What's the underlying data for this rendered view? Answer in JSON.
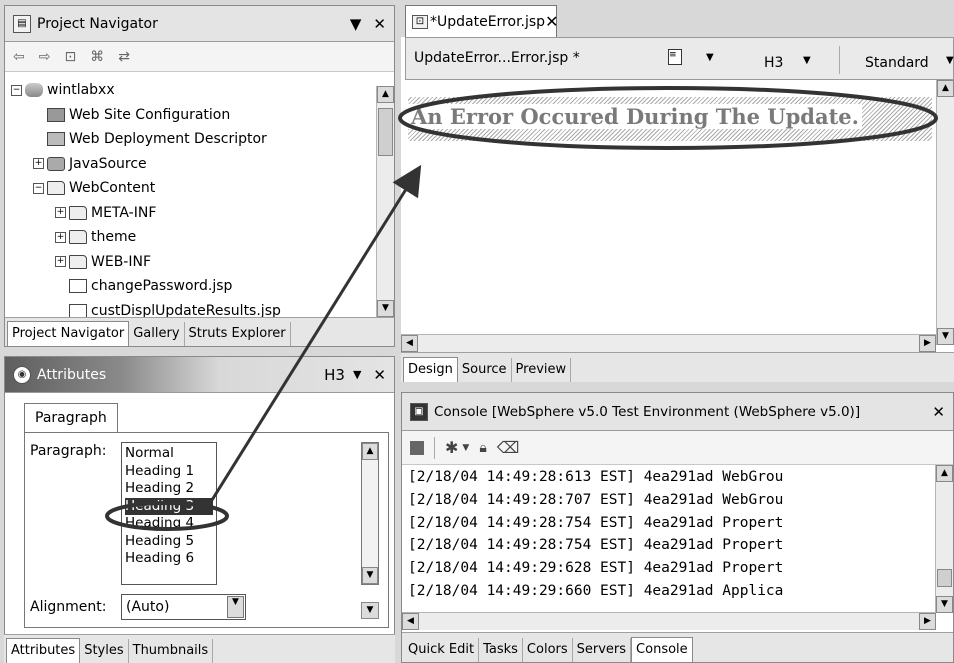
{
  "navigator": {
    "title": "Project Navigator",
    "tree": [
      {
        "label": "wintlabxx",
        "depth": 0,
        "expander": "minus",
        "icon": "proj"
      },
      {
        "label": "Web Site Configuration",
        "depth": 1,
        "expander": "none",
        "icon": "cfg"
      },
      {
        "label": "Web Deployment Descriptor",
        "depth": 1,
        "expander": "none",
        "icon": "dd"
      },
      {
        "label": "JavaSource",
        "depth": 1,
        "expander": "plus",
        "icon": "src"
      },
      {
        "label": "WebContent",
        "depth": 1,
        "expander": "minus",
        "icon": "folder"
      },
      {
        "label": "META-INF",
        "depth": 2,
        "expander": "plus",
        "icon": "folder"
      },
      {
        "label": "theme",
        "depth": 2,
        "expander": "plus",
        "icon": "folder"
      },
      {
        "label": "WEB-INF",
        "depth": 2,
        "expander": "plus",
        "icon": "folder"
      },
      {
        "label": "changePassword.jsp",
        "depth": 2,
        "expander": "none",
        "icon": "jsp"
      },
      {
        "label": "custDisplUpdateResults.jsp",
        "depth": 2,
        "expander": "none",
        "icon": "jsp"
      }
    ],
    "tabs": [
      "Project Navigator",
      "Gallery",
      "Struts Explorer"
    ]
  },
  "attributes": {
    "title": "Attributes",
    "tag_selector": "H3",
    "tab": "Paragraph",
    "paragraph_label": "Paragraph:",
    "paragraph_options": [
      "Normal",
      "Heading 1",
      "Heading 2",
      "Heading 3",
      "Heading 4",
      "Heading 5",
      "Heading 6"
    ],
    "paragraph_selected": "Heading 3",
    "alignment_label": "Alignment:",
    "alignment_value": "(Auto)",
    "tabs": [
      "Attributes",
      "Styles",
      "Thumbnails"
    ]
  },
  "editor": {
    "tab_title": "*UpdateError.jsp",
    "file_crumb": "UpdateError...Error.jsp *",
    "tag_select": "H3",
    "style_select": "Standard",
    "heading_text": "An Error Occured During The Update.",
    "view_tabs": [
      "Design",
      "Source",
      "Preview"
    ]
  },
  "console": {
    "title": "Console [WebSphere v5.0 Test Environment (WebSphere v5.0)]",
    "lines": [
      "[2/18/04 14:49:28:613 EST] 4ea291ad WebGrou",
      "[2/18/04 14:49:28:707 EST] 4ea291ad WebGrou",
      "[2/18/04 14:49:28:754 EST] 4ea291ad Propert",
      "[2/18/04 14:49:28:754 EST] 4ea291ad Propert",
      "[2/18/04 14:49:29:628 EST] 4ea291ad Propert",
      "[2/18/04 14:49:29:660 EST] 4ea291ad Applica"
    ],
    "tabs": [
      "Quick Edit",
      "Tasks",
      "Colors",
      "Servers",
      "Console"
    ]
  },
  "glyphs": {
    "close": "✕",
    "dropdown": "▼",
    "arrow_up": "▲",
    "arrow_down": "▼",
    "arrow_left": "◀",
    "arrow_right": "▶"
  }
}
